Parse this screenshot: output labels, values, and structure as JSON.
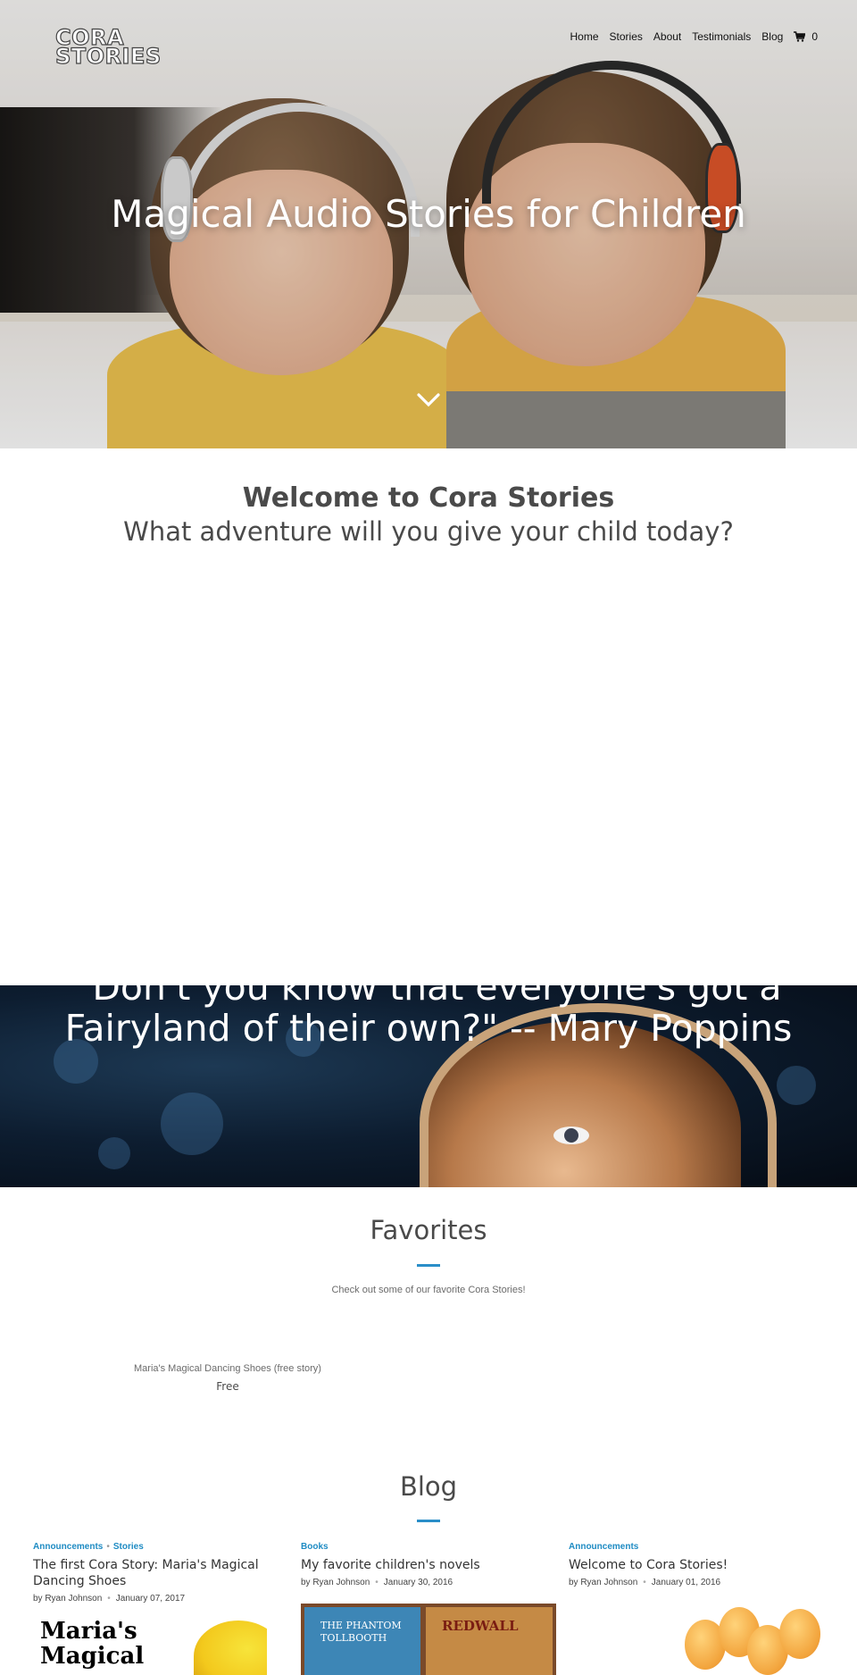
{
  "brand": {
    "logo_line1": "CORA",
    "logo_line2": "STORIES"
  },
  "nav": {
    "items": [
      "Home",
      "Stories",
      "About",
      "Testimonials",
      "Blog"
    ],
    "cart_count": "0",
    "cart_icon": "shopping-cart-icon"
  },
  "hero": {
    "title": "Magical Audio Stories for Children",
    "scroll_icon": "chevron-down-icon"
  },
  "welcome": {
    "title": "Welcome to Cora Stories",
    "subtitle": "What adventure will you give your child today?"
  },
  "quote": {
    "line1": "\"Don't you know that everyone's got a",
    "line2": "Fairyland of their own?\" -- Mary Poppins"
  },
  "favorites": {
    "title": "Favorites",
    "description": "Check out some of our favorite Cora Stories!",
    "products": [
      {
        "name": "Maria's Magical Dancing Shoes (free story)",
        "price": "Free"
      }
    ]
  },
  "blog": {
    "title": "Blog",
    "posts": [
      {
        "categories": [
          "Announcements",
          "Stories"
        ],
        "title": "The first Cora Story: Maria's Magical Dancing Shoes",
        "author": "by Ryan Johnson",
        "date": "January 07, 2017",
        "image_text": "Maria's Magical"
      },
      {
        "categories": [
          "Books"
        ],
        "title": "My favorite children's novels",
        "author": "by Ryan Johnson",
        "date": "January 30, 2016",
        "image_text_1": "THE PHANTOM TOLLBOOTH",
        "image_text_2": "REDWALL"
      },
      {
        "categories": [
          "Announcements"
        ],
        "title": "Welcome to Cora Stories!",
        "author": "by Ryan Johnson",
        "date": "January 01, 2016"
      }
    ]
  },
  "colors": {
    "accent": "#2a8ec8",
    "category": "#1e8bc3",
    "text": "#4a4a4a"
  }
}
